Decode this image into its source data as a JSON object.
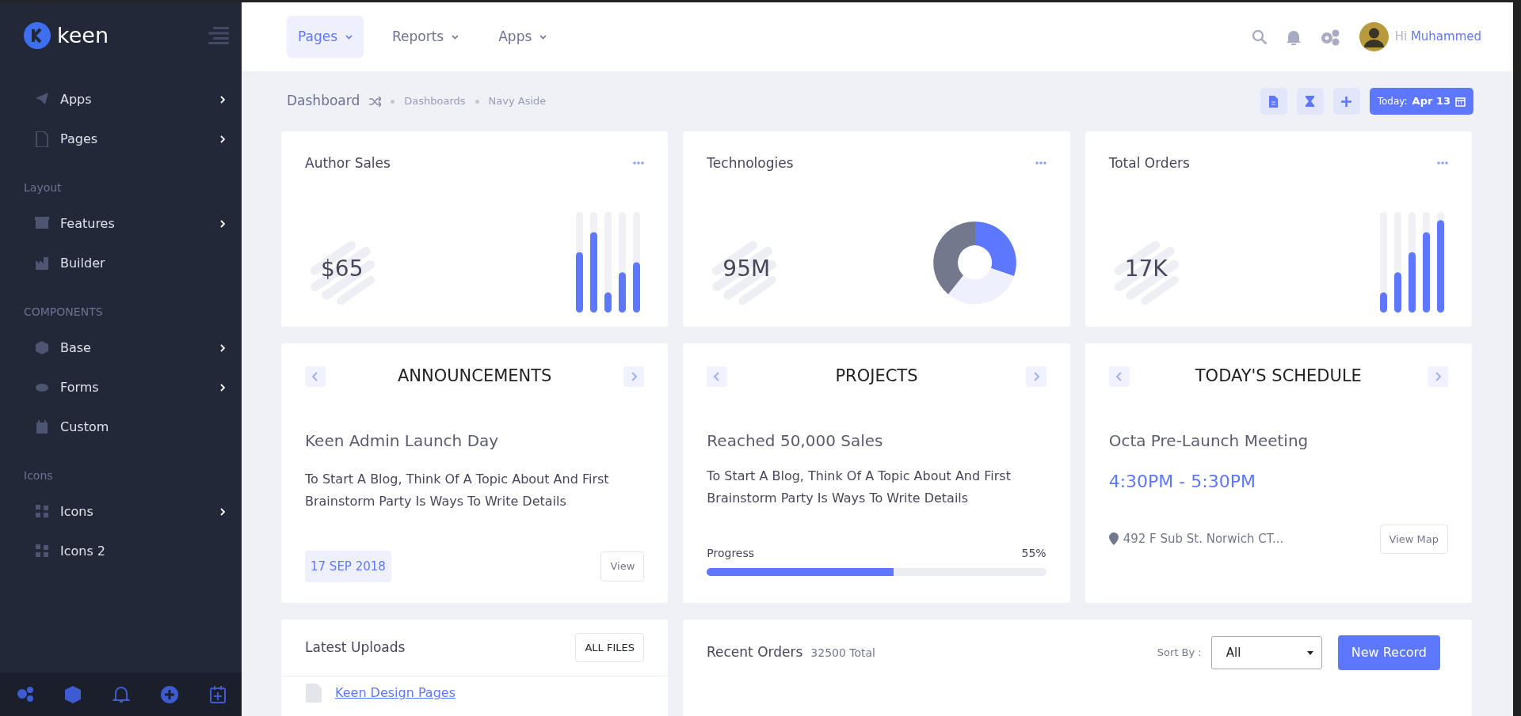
{
  "sidebar": {
    "brand": "keen",
    "groups": [
      {
        "items": [
          {
            "label": "Apps",
            "expandable": true
          },
          {
            "label": "Pages",
            "expandable": true
          }
        ]
      },
      {
        "heading": "Layout",
        "items": [
          {
            "label": "Features",
            "expandable": true
          },
          {
            "label": "Builder",
            "expandable": false
          }
        ]
      },
      {
        "heading": "COMPONENTS",
        "items": [
          {
            "label": "Base",
            "expandable": true
          },
          {
            "label": "Forms",
            "expandable": true
          },
          {
            "label": "Custom",
            "expandable": false
          }
        ]
      },
      {
        "heading": "Icons",
        "items": [
          {
            "label": "Icons",
            "expandable": true
          },
          {
            "label": "Icons 2",
            "expandable": false
          }
        ]
      }
    ]
  },
  "topbar": {
    "tabs": [
      {
        "label": "Pages",
        "selected": true
      },
      {
        "label": "Reports",
        "selected": false
      },
      {
        "label": "Apps",
        "selected": false
      }
    ],
    "greeting": "Hi",
    "user": "Muhammed"
  },
  "subheader": {
    "title": "Dashboard",
    "breadcrumbs": [
      "Dashboards",
      "Navy Aside"
    ],
    "date_label": "Today:",
    "date": "Apr 13"
  },
  "stat_cards": [
    {
      "title": "Author Sales",
      "value": "$65",
      "kind": "bars"
    },
    {
      "title": "Technologies",
      "value": "95M",
      "kind": "donut"
    },
    {
      "title": "Total Orders",
      "value": "17K",
      "kind": "bars"
    }
  ],
  "info_cards": [
    {
      "kind": "announcement",
      "title": "ANNOUNCEMENTS",
      "heading": "Keen Admin Launch Day",
      "text": "To Start A Blog, Think Of A Topic About And First Brainstorm Party Is Ways To Write Details",
      "date": "17 SEP 2018",
      "button": "View"
    },
    {
      "kind": "project",
      "title": "PROJECTS",
      "heading": "Reached 50,000 Sales",
      "text": "To Start A Blog, Think Of A Topic About And First Brainstorm Party Is Ways To Write Details",
      "progress_label": "Progress",
      "progress_value": "55%",
      "level": 0.55
    },
    {
      "kind": "schedule",
      "title": "TODAY'S SCHEDULE",
      "heading": "Octa Pre-Launch Meeting",
      "time": "4:30PM - 5:30PM",
      "address": "492 F Sub St. Norwich CT...",
      "button": "View Map"
    }
  ],
  "uploads": {
    "title": "Latest Uploads",
    "button": "ALL FILES",
    "files": [
      "Keen Design Pages"
    ]
  },
  "orders": {
    "title": "Recent Orders",
    "total": "32500 Total",
    "sort_label": "Sort By :",
    "sort_value": "All",
    "button": "New Record"
  }
}
